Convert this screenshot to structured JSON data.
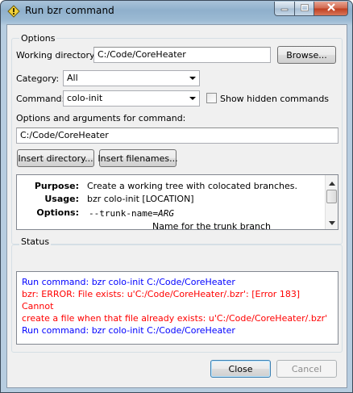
{
  "window": {
    "title": "Run bzr command"
  },
  "options_group": {
    "label": "Options",
    "working_directory": {
      "label": "Working directory:",
      "value": "C:/Code/CoreHeater",
      "browse_label": "Browse..."
    },
    "category": {
      "label": "Category:",
      "value": "All"
    },
    "command": {
      "label": "Command:",
      "value": "colo-init",
      "show_hidden_label": "Show hidden commands",
      "show_hidden_checked": false
    },
    "arguments": {
      "label": "Options and arguments for command:",
      "value": "C:/Code/CoreHeater"
    },
    "insert_directory_label": "Insert directory...",
    "insert_filenames_label": "Insert filenames...",
    "help": {
      "purpose_key": "Purpose:",
      "purpose_value": "Create a working tree with colocated branches.",
      "usage_key": "Usage:",
      "usage_value": "bzr colo-init [LOCATION]",
      "options_key": "Options:",
      "option_name": "--trunk-name=",
      "option_arg": "ARG",
      "option_desc": "Name for the trunk branch"
    }
  },
  "status_group": {
    "label": "Status",
    "log": [
      {
        "text": "Run command: bzr colo-init C:/Code/CoreHeater",
        "color": "#0000ff"
      },
      {
        "text": "bzr: ERROR: File exists: u'C:/Code/CoreHeater/.bzr': [Error 183] Cannot",
        "color": "#ff0000"
      },
      {
        "text": "create a file when that file already exists: u'C:/Code/CoreHeater/.bzr'",
        "color": "#ff0000"
      },
      {
        "text": "Run command: bzr colo-init C:/Code/CoreHeater",
        "color": "#0000ff"
      }
    ]
  },
  "footer": {
    "close_label": "Close",
    "cancel_label": "Cancel"
  },
  "colors": {
    "info": "#0000ff",
    "error": "#ff0000"
  }
}
